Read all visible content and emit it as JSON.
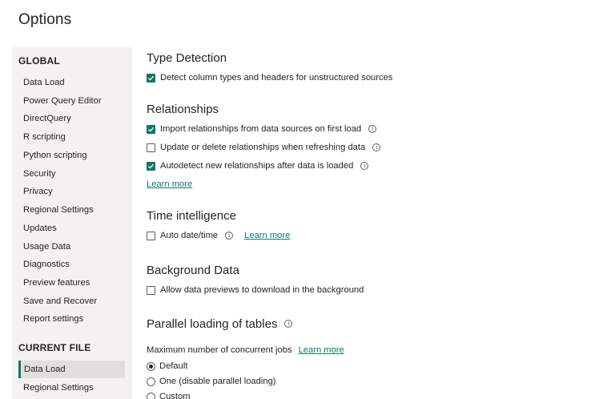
{
  "page_title": "Options",
  "sidebar": {
    "global_header": "GLOBAL",
    "global_items": [
      {
        "label": "Data Load"
      },
      {
        "label": "Power Query Editor"
      },
      {
        "label": "DirectQuery"
      },
      {
        "label": "R scripting"
      },
      {
        "label": "Python scripting"
      },
      {
        "label": "Security"
      },
      {
        "label": "Privacy"
      },
      {
        "label": "Regional Settings"
      },
      {
        "label": "Updates"
      },
      {
        "label": "Usage Data"
      },
      {
        "label": "Diagnostics"
      },
      {
        "label": "Preview features"
      },
      {
        "label": "Save and Recover"
      },
      {
        "label": "Report settings"
      }
    ],
    "current_header": "CURRENT FILE",
    "current_items": [
      {
        "label": "Data Load",
        "selected": true
      },
      {
        "label": "Regional Settings",
        "selected": false
      }
    ]
  },
  "sections": {
    "type_detection": {
      "heading": "Type Detection",
      "detect_label": "Detect column types and headers for unstructured sources",
      "detect_checked": true
    },
    "relationships": {
      "heading": "Relationships",
      "import_label": "Import relationships from data sources on first load",
      "import_checked": true,
      "update_label": "Update or delete relationships when refreshing data",
      "update_checked": false,
      "autodetect_label": "Autodetect new relationships after data is loaded",
      "autodetect_checked": true,
      "learn_more": "Learn more"
    },
    "time_intelligence": {
      "heading": "Time intelligence",
      "auto_label": "Auto date/time",
      "auto_checked": false,
      "learn_more": "Learn more"
    },
    "background_data": {
      "heading": "Background Data",
      "allow_label": "Allow data previews to download in the background",
      "allow_checked": false
    },
    "parallel_loading": {
      "heading": "Parallel loading of tables",
      "max_label": "Maximum number of concurrent jobs",
      "learn_more": "Learn more",
      "options": [
        {
          "label": "Default",
          "selected": true
        },
        {
          "label": "One (disable parallel loading)",
          "selected": false
        },
        {
          "label": "Custom",
          "selected": false
        }
      ]
    }
  },
  "icons": {
    "info": "info-icon",
    "check": "checkmark-icon"
  },
  "colors": {
    "accent": "#117865",
    "sidebar_bg": "#f3f2f1",
    "selected_bg": "#e1dfdd",
    "text": "#252423"
  }
}
